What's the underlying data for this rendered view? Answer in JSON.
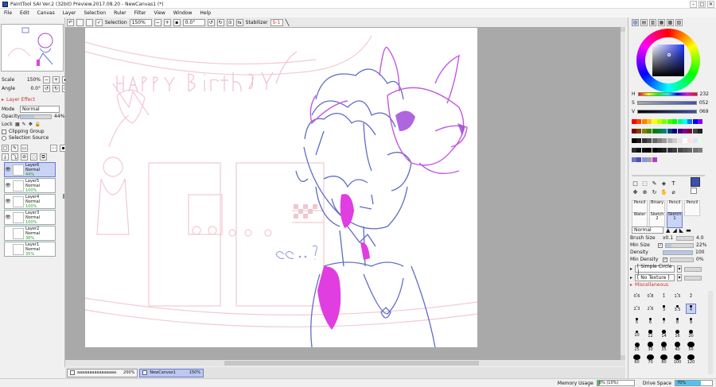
{
  "window": {
    "title": "PaintTool SAI Ver.2 (32bit) Preview.2017.08.20 - NewCanvas1 (*)"
  },
  "menu": [
    "File",
    "Edit",
    "Canvas",
    "Layer",
    "Selection",
    "Ruler",
    "Filter",
    "View",
    "Window",
    "Help"
  ],
  "toolbar": {
    "selection_label": "Selection",
    "zoom": "150%",
    "angle": "0.0°",
    "stabilizer_label": "Stabilizer",
    "stabilizer_value": "S-1"
  },
  "navigator": {
    "scale_label": "Scale",
    "scale_value": "150%",
    "angle_label": "Angle",
    "angle_value": "0.0°"
  },
  "layer_panel": {
    "effect_label": "Layer Effect",
    "mode_label": "Mode",
    "mode_value": "Normal",
    "opacity_label": "Opacity",
    "opacity_value": "44%",
    "opacity_fraction": 0.44,
    "lock_label": "Lock",
    "clipping_label": "Clipping Group",
    "selection_source_label": "Selection Source",
    "layers": [
      {
        "name": "Layer6",
        "mode": "Normal",
        "opacity": "44%",
        "visible": true,
        "selected": true
      },
      {
        "name": "Layer5",
        "mode": "Normal",
        "opacity": "100%",
        "visible": true,
        "selected": false
      },
      {
        "name": "Layer4",
        "mode": "Normal",
        "opacity": "100%",
        "visible": true,
        "selected": false
      },
      {
        "name": "Layer3",
        "mode": "Normal",
        "opacity": "100%",
        "visible": true,
        "selected": false
      },
      {
        "name": "Layer2",
        "mode": "Normal",
        "opacity": "38%",
        "visible": false,
        "selected": false
      },
      {
        "name": "Layer1",
        "mode": "Normal",
        "opacity": "35%",
        "visible": false,
        "selected": false
      }
    ]
  },
  "tabs": [
    {
      "name": "aaaaaaaaaaaaaaaa",
      "zoom": "200%",
      "active": false
    },
    {
      "name": "NewCanvas1",
      "zoom": "150%",
      "active": true
    }
  ],
  "status": {
    "memory_label": "Memory Usage",
    "memory_value": "8% (10%)",
    "memory_fraction": 0.08,
    "drive_label": "Drive Space",
    "drive_value": "70%",
    "drive_fraction": 0.7
  },
  "color": {
    "current": "#3d4fb0",
    "h_label": "H",
    "h_value": "232",
    "s_label": "S",
    "s_value": "052",
    "v_label": "V",
    "v_value": "069"
  },
  "brush": {
    "blend_mode": "Normal",
    "size_label": "Brush Size",
    "size_mult": "x0.1",
    "size_value": "4.0",
    "min_size_label": "Min Size",
    "min_size_value": "22%",
    "min_size_fraction": 0.22,
    "density_label": "Density",
    "density_value": "100",
    "density_fraction": 1.0,
    "min_density_label": "Min Density",
    "min_density_value": "0%",
    "min_density_fraction": 0.0,
    "shape_label": "[ Simple Circle ]",
    "texture_label": "[ No Texture ]",
    "misc_label": "Miscellaneous",
    "tools": [
      "Pencil",
      "Binary",
      "Pencil",
      "Pencil",
      "Water",
      "Sketch",
      "Sketch"
    ],
    "tool_numbers": [
      "",
      "",
      "",
      "",
      "",
      "2",
      "1"
    ],
    "sizes": [
      "0.6",
      "0.8",
      "1",
      "1.5",
      "2",
      "2.3",
      "2.6",
      "3",
      "3.5",
      "4",
      "5",
      "6",
      "7",
      "8",
      "9",
      "10",
      "12",
      "14",
      "16",
      "20",
      "25",
      "30",
      "35",
      "40",
      "50",
      "60",
      "70",
      "80",
      "100",
      "120"
    ]
  }
}
